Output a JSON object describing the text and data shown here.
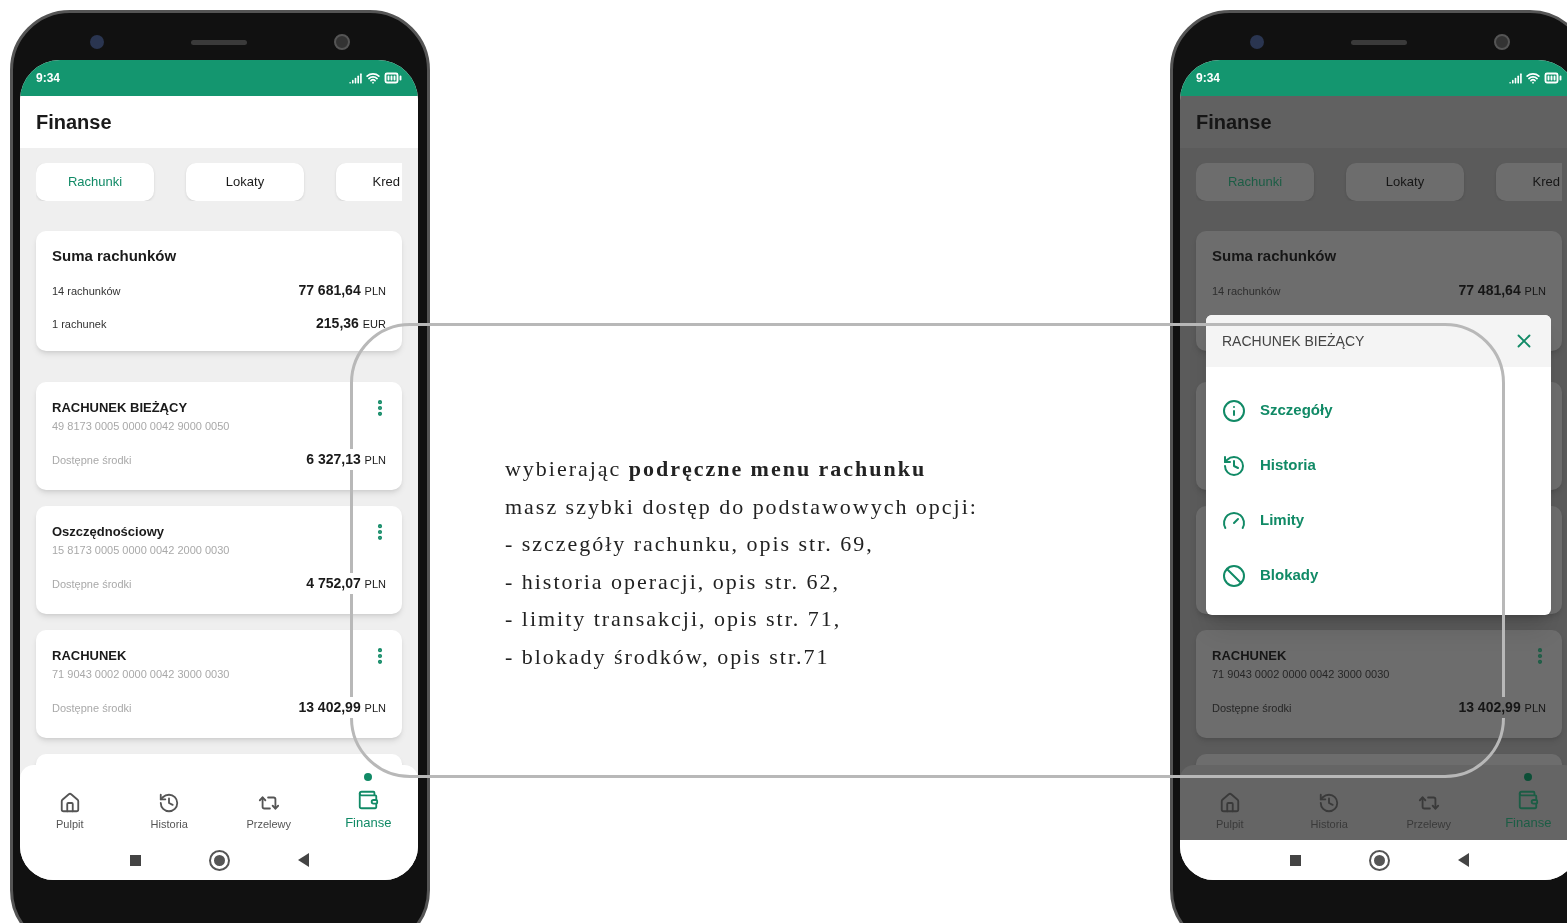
{
  "phones": [
    {
      "dimmed": false,
      "status_time": "9:34",
      "title": "Finanse",
      "tabs": [
        {
          "label": "Rachunki",
          "selected": true
        },
        {
          "label": "Lokaty",
          "selected": false
        },
        {
          "label": "Kred",
          "selected": false
        }
      ],
      "summary": {
        "title": "Suma rachunków",
        "rows": [
          {
            "label": "14 rachunków",
            "amount": "77 681,64",
            "currency": "PLN"
          },
          {
            "label": "1 rachunek",
            "amount": "215,36",
            "currency": "EUR"
          }
        ]
      },
      "accounts": [
        {
          "kind": "full",
          "name": "RACHUNEK BIEŻĄCY",
          "number": "49 8173 0005 0000 0042 9000 0050",
          "balance_label": "Dostępne środki",
          "amount": "6 327,13",
          "currency": "PLN"
        },
        {
          "kind": "full",
          "name": "Oszczędnościowy",
          "number": "15 8173 0005 0000 0042 2000 0030",
          "balance_label": "Dostępne środki",
          "amount": "4 752,07",
          "currency": "PLN"
        },
        {
          "kind": "full",
          "name": "RACHUNEK",
          "number": "71 9043 0002 0000 0042 3000 0030",
          "balance_label": "Dostępne środki",
          "amount": "13 402,99",
          "currency": "PLN"
        },
        {
          "kind": "partial"
        }
      ],
      "nav": [
        {
          "label": "Pulpit",
          "selected": false
        },
        {
          "label": "Historia",
          "selected": false
        },
        {
          "label": "Przelewy",
          "selected": false
        },
        {
          "label": "Finanse",
          "selected": true
        }
      ]
    },
    {
      "dimmed": true,
      "status_time": "9:34",
      "title": "Finanse",
      "tabs": [
        {
          "label": "Rachunki",
          "selected": true
        },
        {
          "label": "Lokaty",
          "selected": false
        },
        {
          "label": "Kred",
          "selected": false
        }
      ],
      "summary": {
        "title": "Suma rachunków",
        "rows": [
          {
            "label": "14 rachunków",
            "amount": "77 481,64",
            "currency": "PLN"
          }
        ]
      },
      "accounts": [
        {
          "kind": "covered"
        },
        {
          "kind": "covered"
        },
        {
          "kind": "full",
          "name": "RACHUNEK",
          "number": "71 9043 0002 0000 0042 3000 0030",
          "balance_label": "Dostępne środki",
          "amount": "13 402,99",
          "currency": "PLN"
        },
        {
          "kind": "partial"
        }
      ],
      "nav": [
        {
          "label": "Pulpit",
          "selected": false
        },
        {
          "label": "Historia",
          "selected": false
        },
        {
          "label": "Przelewy",
          "selected": false
        },
        {
          "label": "Finanse",
          "selected": true
        }
      ],
      "menu": {
        "title": "RACHUNEK BIEŻĄCY",
        "items": [
          {
            "label": "Szczegóły"
          },
          {
            "label": "Historia"
          },
          {
            "label": "Limity"
          },
          {
            "label": "Blokady"
          }
        ]
      }
    }
  ],
  "description": {
    "lines": [
      "wybierając **podręczne menu rachunku**",
      "masz szybki dostęp do podstawowych opcji:",
      "- szczegóły rachunku, opis str. 69,",
      "- historia operacji, opis str. 62,",
      "- limity transakcji, opis str. 71,",
      "- blokady środków, opis str.71"
    ]
  }
}
